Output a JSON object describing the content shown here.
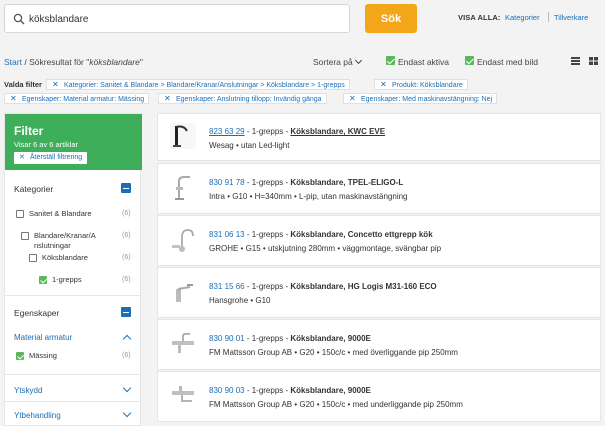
{
  "search": {
    "value": "köksblandare",
    "button": "Sök"
  },
  "visa_alla": {
    "label": "VISA ALLA:",
    "links": [
      "Kategorier",
      "Tillverkare"
    ]
  },
  "breadcrumb": {
    "start": "Start",
    "separator": "/",
    "prefix": "Sökresultat för \"",
    "query": "köksblandare",
    "suffix": "\""
  },
  "toolbar": {
    "sort_label": "Sortera på",
    "only_active": "Endast aktiva",
    "only_with_image": "Endast med bild"
  },
  "active_filters": {
    "label": "Valda filter",
    "chips": [
      "Kategorier: Sanitet & Blandare > Blandare/Kranar/Anslutningar > Köksblandare > 1-grepps",
      "Produkt: Köksblandare",
      "Egenskaper: Material armatur: Mässing",
      "Egenskaper: Anslutning tillopp: Invändig gänga",
      "Egenskaper: Med maskinavstängning: Nej"
    ]
  },
  "sidebar": {
    "title": "Filter",
    "subtitle": "Visar 6 av 6 artiklar",
    "reset": "Återställ filtrering",
    "categories_title": "Kategorier",
    "categories": [
      {
        "label": "Sanitet & Blandare",
        "count": "(6)"
      },
      {
        "label1": "Blandare/Kranar/A",
        "label2": "nslutningar",
        "count": "(6)"
      },
      {
        "label": "Köksblandare",
        "count": "(6)"
      },
      {
        "label": "1-grepps",
        "count": "(6)"
      }
    ],
    "properties_title": "Egenskaper",
    "material_title": "Material armatur",
    "material_option": {
      "label": "Mässing",
      "count": "(6)"
    },
    "ytskydd": "Ytskydd",
    "ytbehandling": "Ytbehandling"
  },
  "results": [
    {
      "number": "823 63 29",
      "type": "1-grepps",
      "name": "Köksblandare, KWC EVE",
      "details": "Wesag • utan Led-light"
    },
    {
      "number": "830 91 78",
      "type": "1-grepps",
      "name": "Köksblandare, TPEL-ELIGO-L",
      "details": "Intra • G10 • H=340mm • L-pip, utan maskinavstängning"
    },
    {
      "number": "831 06 13",
      "type": "1-grepps",
      "name": "Köksblandare, Concetto ettgrepp kök",
      "details": "GROHE • G15 • utskjutning 280mm • väggmontage, svängbar pip"
    },
    {
      "number": "831 15 66",
      "type": "1-grepps",
      "name": "Köksblandare, HG Logis M31-160 ECO",
      "details": "Hansgrohe • G10"
    },
    {
      "number": "830 90 01",
      "type": "1-grepps",
      "name": "Köksblandare, 9000E",
      "details": "FM Mattsson Group AB • G20 • 150c/c • med överliggande pip 250mm"
    },
    {
      "number": "830 90 03",
      "type": "1-grepps",
      "name": "Köksblandare, 9000E",
      "details": "FM Mattsson Group AB • G20 • 150c/c • med underliggande pip 250mm"
    }
  ],
  "colors": {
    "accent": "#3fae5a",
    "link": "#1b6fb8",
    "button": "#f4a61a"
  }
}
